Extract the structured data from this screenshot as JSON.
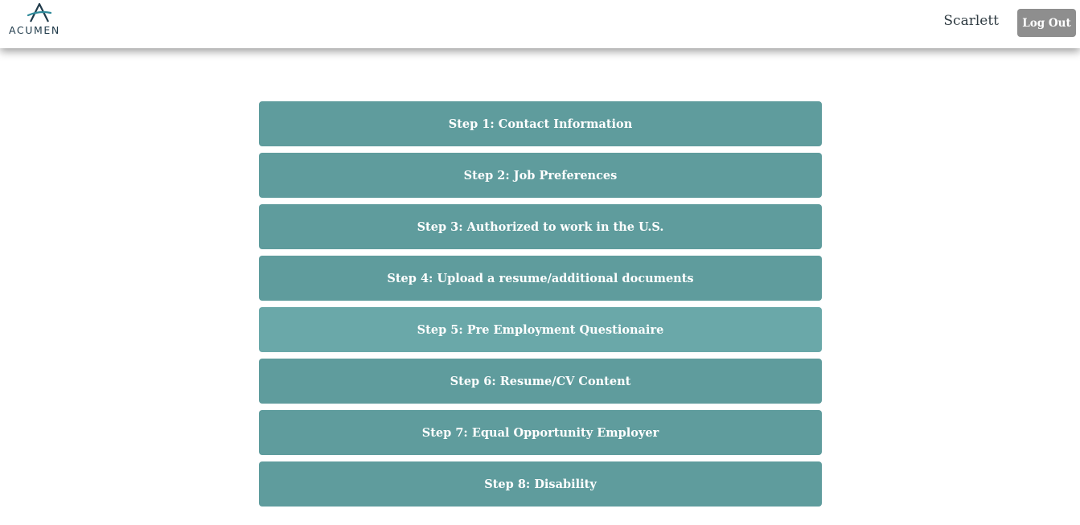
{
  "header": {
    "logo_text": "ACUMEN",
    "username": "Scarlett",
    "logout_label": "Log Out"
  },
  "steps": [
    {
      "label": "Step 1: Contact Information"
    },
    {
      "label": "Step 2: Job Preferences"
    },
    {
      "label": "Step 3: Authorized to work in the U.S."
    },
    {
      "label": "Step 4: Upload a resume/additional documents"
    },
    {
      "label": "Step 5: Pre Employment Questionaire"
    },
    {
      "label": "Step 6: Resume/CV Content"
    },
    {
      "label": "Step 7: Equal Opportunity Employer"
    },
    {
      "label": "Step 8: Disability"
    }
  ],
  "colors": {
    "step_background": "#5f9c9d",
    "step_hover_background": "#6aa8a9",
    "logout_background": "#8e8e8e",
    "logo_color": "#1f3a4a"
  }
}
